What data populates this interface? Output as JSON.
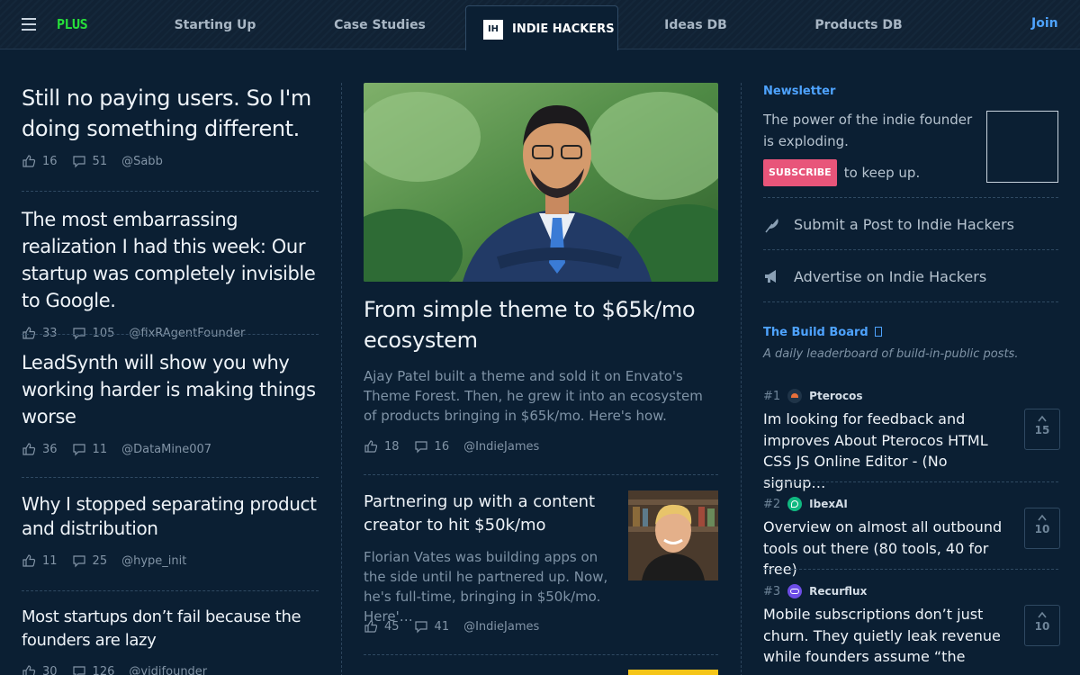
{
  "header": {
    "plus_label": "PLUS",
    "nav": [
      "Starting Up",
      "Case Studies",
      "Ideas DB",
      "Products DB"
    ],
    "brand_logo": "IH",
    "brand_label": "INDIE HACKERS",
    "join_label": "Join"
  },
  "left_posts": [
    {
      "title": "Still no paying users. So I'm doing something different.",
      "likes": "16",
      "comments": "51",
      "author": "@Sabb"
    },
    {
      "title": "The most embarrassing realization I had this week: Our startup was completely invisible to Google.",
      "likes": "33",
      "comments": "105",
      "author": "@fixRAgentFounder"
    },
    {
      "title": "LeadSynth will show you why working harder is making things worse",
      "likes": "36",
      "comments": "11",
      "author": "@DataMine007"
    },
    {
      "title": "Why I stopped separating product and distribution",
      "likes": "11",
      "comments": "25",
      "author": "@hype_init"
    },
    {
      "title": "Most startups don’t fail because the founders are lazy",
      "likes": "30",
      "comments": "126",
      "author": "@vidifounder"
    }
  ],
  "featured": {
    "title": "From simple theme to $65k/mo ecosystem",
    "description": "Ajay Patel built a theme and sold it on Envato's Theme Forest. Then, he grew it into an ecosystem of products bringing in $65k/mo. Here's how.",
    "likes": "18",
    "comments": "16",
    "author": "@IndieJames"
  },
  "mid_posts": [
    {
      "title": "Partnering up with a content creator to hit $50k/mo",
      "description": "Florian Vates was building apps on the side until he partnered up. Now, he's full-time, bringing in $50k/mo. Here'…",
      "likes": "45",
      "comments": "41",
      "author": "@IndieJames"
    }
  ],
  "sidebar": {
    "newsletter_label": "Newsletter",
    "newsletter_text": "The power of the indie founder is exploding.",
    "subscribe_label": "SUBSCRIBE",
    "subscribe_suffix": "to keep up.",
    "submit_link": "Submit a Post to Indie Hackers",
    "advertise_link": "Advertise on Indie Hackers",
    "build_board_label": "The Build Board",
    "build_board_icon": "external-link-icon",
    "build_board_sub": "A daily leaderboard of build-in-public posts.",
    "board": [
      {
        "rank": "#1",
        "name": "Pterocos",
        "title": "Im looking for feedback and improves About Pterocos HTML CSS JS Online Editor - (No signup…",
        "votes": "15",
        "logo_color": "#1f3448",
        "accent": "#e8703a"
      },
      {
        "rank": "#2",
        "name": "IbexAI",
        "title": "Overview on almost all outbound tools out there (80 tools, 40 for free)",
        "votes": "10",
        "logo_color": "#10b981",
        "accent": "#ffffff"
      },
      {
        "rank": "#3",
        "name": "Recurflux",
        "title": "Mobile subscriptions don’t just churn. They quietly leak revenue while founders assume “the app…",
        "votes": "10",
        "logo_color": "#6d4de6",
        "accent": "#ffffff"
      }
    ]
  },
  "colors": {
    "background": "#0b1f33",
    "accent_blue": "#4ea3ff",
    "plus_green": "#27e03a",
    "subscribe_pink": "#e8557a"
  }
}
